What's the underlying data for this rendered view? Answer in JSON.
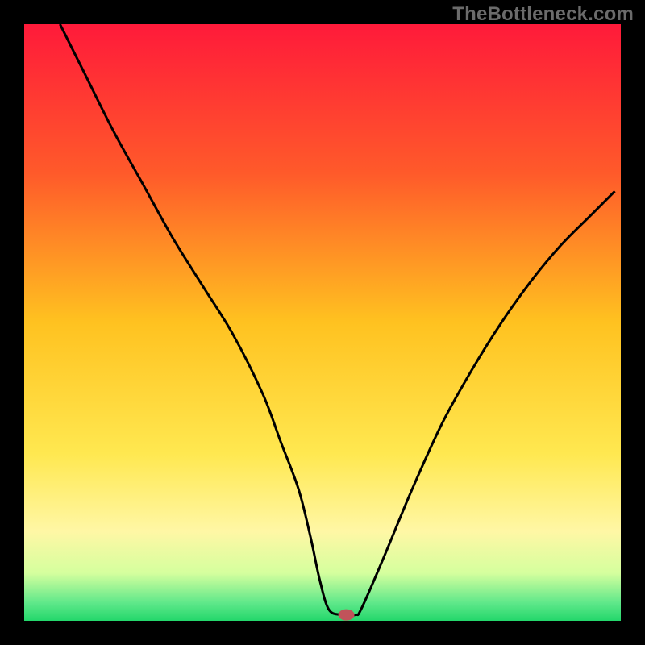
{
  "watermark": "TheBottleneck.com",
  "chart_data": {
    "type": "line",
    "title": "",
    "xlabel": "",
    "ylabel": "",
    "xlim": [
      0,
      100
    ],
    "ylim": [
      0,
      100
    ],
    "grid": false,
    "legend": false,
    "background": {
      "type": "vertical-gradient",
      "stops": [
        {
          "pos": 0,
          "color": "#ff1a3a"
        },
        {
          "pos": 25,
          "color": "#ff5a2a"
        },
        {
          "pos": 50,
          "color": "#ffc220"
        },
        {
          "pos": 72,
          "color": "#ffe850"
        },
        {
          "pos": 85,
          "color": "#fff7a5"
        },
        {
          "pos": 92,
          "color": "#d5ff9e"
        },
        {
          "pos": 97,
          "color": "#5fe88a"
        },
        {
          "pos": 100,
          "color": "#23d76b"
        }
      ]
    },
    "series": [
      {
        "name": "bottleneck-curve",
        "type": "line",
        "color": "#000000",
        "width": 3,
        "x": [
          6,
          10,
          15,
          20,
          25,
          30,
          35,
          40,
          43,
          46,
          48,
          49.5,
          51,
          53,
          55.5,
          56.5,
          60,
          65,
          70,
          75,
          80,
          85,
          90,
          95,
          99
        ],
        "values": [
          100,
          92,
          82,
          73,
          64,
          56,
          48,
          38,
          30,
          22,
          14,
          7,
          2,
          1,
          1,
          2,
          10,
          22,
          33,
          42,
          50,
          57,
          63,
          68,
          72
        ]
      }
    ],
    "marker": {
      "name": "optimal-point",
      "x": 54,
      "y": 1,
      "color": "#c1535a",
      "rx": 10,
      "ry": 7
    }
  }
}
